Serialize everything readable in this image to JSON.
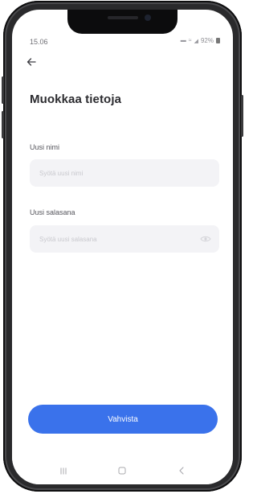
{
  "status_bar": {
    "time": "15.06",
    "battery_percent": "92%",
    "icons": [
      "silent-mode-icon",
      "wifi-icon",
      "signal-icon",
      "battery-icon"
    ]
  },
  "header": {
    "back_icon": "back-arrow-icon",
    "title": "Muokkaa tietoja"
  },
  "form": {
    "name_label": "Uusi nimi",
    "name_placeholder": "Syötä uusi nimi",
    "password_label": "Uusi salasana",
    "password_placeholder": "Syötä uusi salasana",
    "password_visibility_icon": "eye-icon"
  },
  "confirm_button": {
    "label": "Vahvista"
  },
  "nav_bar": {
    "icons": [
      "recent-apps-icon",
      "home-icon",
      "back-icon"
    ]
  },
  "colors": {
    "accent": "#3a72eb",
    "input_background": "#f3f3f6",
    "title_text": "#2c2c30",
    "phone_frame": "#2a2a2c"
  }
}
